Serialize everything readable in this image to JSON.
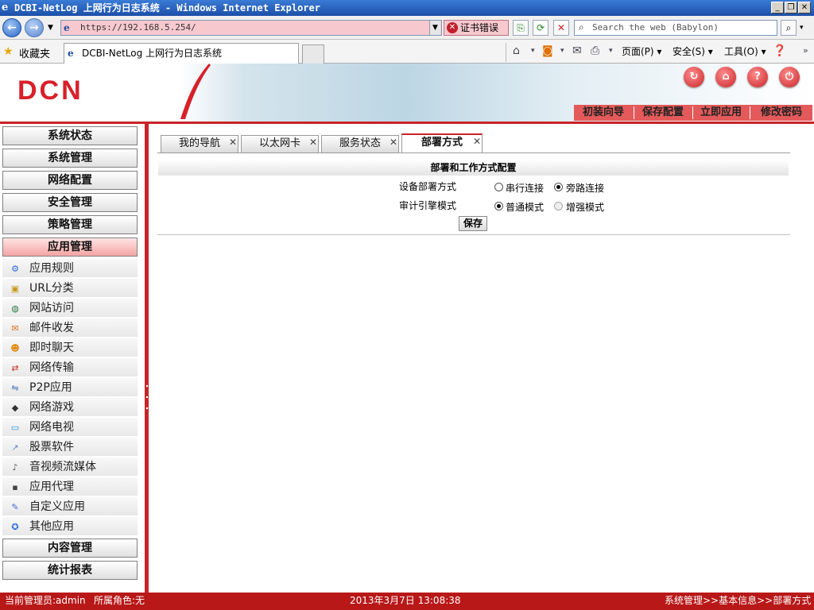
{
  "window": {
    "title": "DCBI-NetLog 上网行为日志系统 - Windows Internet Explorer"
  },
  "browser": {
    "url": "https://192.168.5.254/",
    "cert_error": "证书错误",
    "search_placeholder": "Search the web (Babylon)",
    "favorites_label": "收藏夹",
    "tab_title": "DCBI-NetLog 上网行为日志系统",
    "commands": {
      "page": "页面(P)",
      "safety": "安全(S)",
      "tools": "工具(O)"
    }
  },
  "app": {
    "logo_text": "DCN",
    "top_nav": [
      "初装向导",
      "保存配置",
      "立即应用",
      "修改密码"
    ],
    "sidebar": {
      "categories_top": [
        "系统状态",
        "系统管理",
        "网络配置",
        "安全管理",
        "策略管理",
        "应用管理"
      ],
      "active_category": "应用管理",
      "items": [
        {
          "label": "应用规则",
          "icon": "gear-icon"
        },
        {
          "label": "URL分类",
          "icon": "box-icon"
        },
        {
          "label": "网站访问",
          "icon": "globe-icon"
        },
        {
          "label": "邮件收发",
          "icon": "mail-icon"
        },
        {
          "label": "即时聊天",
          "icon": "chat-icon"
        },
        {
          "label": "网络传输",
          "icon": "transfer-icon"
        },
        {
          "label": "P2P应用",
          "icon": "p2p-icon"
        },
        {
          "label": "网络游戏",
          "icon": "gamepad-icon"
        },
        {
          "label": "网络电视",
          "icon": "tv-icon"
        },
        {
          "label": "股票软件",
          "icon": "stock-icon"
        },
        {
          "label": "音视频流媒体",
          "icon": "media-icon"
        },
        {
          "label": "应用代理",
          "icon": "proxy-icon"
        },
        {
          "label": "自定义应用",
          "icon": "custom-icon"
        },
        {
          "label": "其他应用",
          "icon": "other-icon"
        }
      ],
      "categories_bottom": [
        "内容管理",
        "统计报表"
      ]
    },
    "tabs": [
      {
        "label": "我的导航",
        "active": false
      },
      {
        "label": "以太网卡",
        "active": false
      },
      {
        "label": "服务状态",
        "active": false
      },
      {
        "label": "部署方式",
        "active": true
      }
    ],
    "form": {
      "section_title": "部署和工作方式配置",
      "deploy_label": "设备部署方式",
      "deploy_options": [
        {
          "label": "串行连接",
          "checked": false
        },
        {
          "label": "旁路连接",
          "checked": true
        }
      ],
      "engine_label": "审计引擎模式",
      "engine_options": [
        {
          "label": "普通模式",
          "checked": true
        },
        {
          "label": "增强模式",
          "checked": false
        }
      ],
      "save_label": "保存"
    },
    "status": {
      "admin": "当前管理员:admin",
      "role": "所属角色:无",
      "datetime": "2013年3月7日 13:08:38",
      "breadcrumb": "系统管理>>基本信息>>部署方式"
    }
  }
}
